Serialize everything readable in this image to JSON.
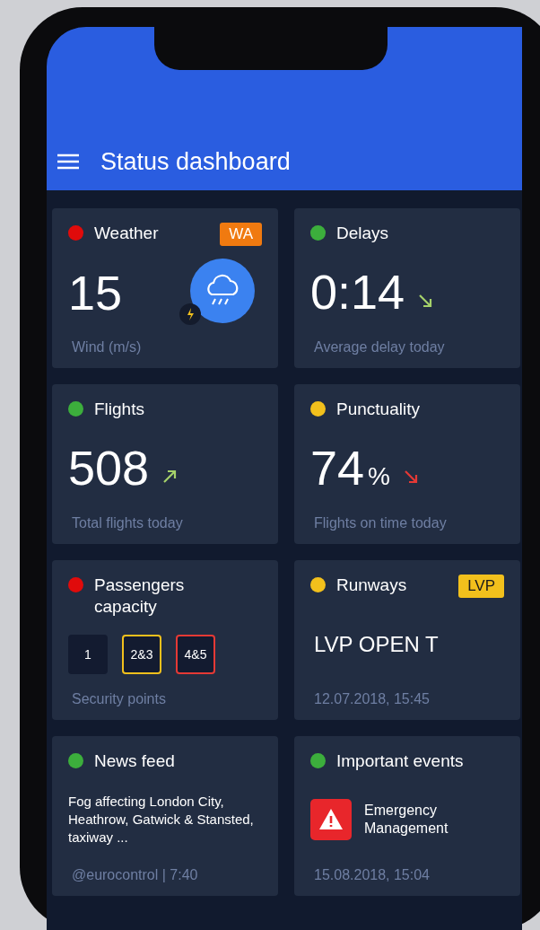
{
  "header": {
    "title": "Status dashboard"
  },
  "cards": [
    {
      "kind": "weather",
      "title": "Weather",
      "color": "#e00b0b",
      "badge": {
        "label": "WA",
        "color": "#f07a10"
      },
      "value": "15",
      "caption": "Wind (m/s)"
    },
    {
      "kind": "metric",
      "title": "Delays",
      "color": "#3cae3c",
      "value": "0:14",
      "trend": {
        "rising": false,
        "color": "#a5d16a"
      },
      "caption": "Average delay today"
    },
    {
      "kind": "metric",
      "title": "Flights",
      "color": "#3cae3c",
      "value": "508",
      "trend": {
        "rising": true,
        "color": "#a5d16a"
      },
      "caption": "Total flights today"
    },
    {
      "kind": "metric",
      "title": "Punctuality",
      "color": "#f2c01c",
      "value": "74",
      "unit": "%",
      "trend": {
        "rising": false,
        "color": "#e53935"
      },
      "caption": "Flights on time today"
    },
    {
      "kind": "chips",
      "title": "Passengers capacity",
      "color": "#e00b0b",
      "chips": [
        {
          "label": "1",
          "color": "#131b30"
        },
        {
          "label": "2&3",
          "color": "#f2c01c"
        },
        {
          "label": "4&5",
          "color": "#e53935"
        }
      ],
      "caption": "Security points"
    },
    {
      "kind": "text",
      "title": "Runways",
      "color": "#f2c01c",
      "badge": {
        "label": "LVP",
        "color": "#f2c01c"
      },
      "value": "LVP OPEN T",
      "caption": "12.07.2018, 15:45"
    },
    {
      "kind": "news",
      "title": "News feed",
      "color": "#3cae3c",
      "text": "Fog affecting London City, Heathrow, Gatwick & Stansted, taxiway ...",
      "caption": "@eurocontrol | 7:40"
    },
    {
      "kind": "event",
      "title": "Important events",
      "color": "#3cae3c",
      "text": "Emergency Management",
      "caption": "15.08.2018, 15:04"
    }
  ]
}
